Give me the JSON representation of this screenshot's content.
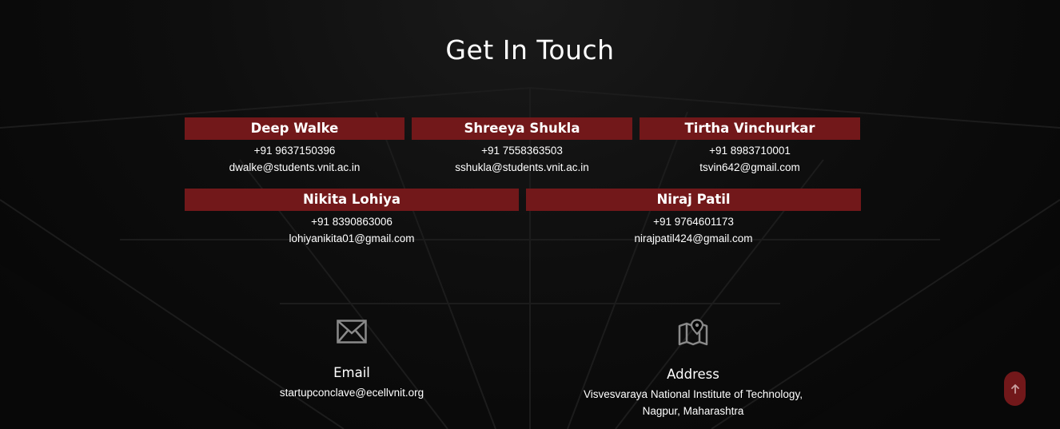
{
  "section": {
    "title": "Get In Touch"
  },
  "contacts_row1": [
    {
      "name": "Deep Walke",
      "phone": "+91 9637150396",
      "email": "dwalke@students.vnit.ac.in"
    },
    {
      "name": "Shreeya Shukla",
      "phone": "+91 7558363503",
      "email": "sshukla@students.vnit.ac.in"
    },
    {
      "name": "Tirtha Vinchurkar",
      "phone": "+91 8983710001",
      "email": "tsvin642@gmail.com"
    }
  ],
  "contacts_row2": [
    {
      "name": "Nikita Lohiya",
      "phone": "+91 8390863006",
      "email": "lohiyanikita01@gmail.com"
    },
    {
      "name": "Niraj Patil",
      "phone": "+91 9764601173",
      "email": "nirajpatil424@gmail.com"
    }
  ],
  "email_block": {
    "icon": "envelope-icon",
    "label": "Email",
    "value": "startupconclave@ecellvnit.org"
  },
  "address_block": {
    "icon": "map-pin-icon",
    "label": "Address",
    "line1": "Visvesvaraya National Institute of Technology,",
    "line2": "Nagpur, Maharashtra"
  },
  "scroll_top": {
    "icon": "arrow-up-icon"
  },
  "colors": {
    "accent": "#72181a",
    "background": "#000000",
    "text": "#ffffff",
    "icon": "#8a8a8a"
  }
}
